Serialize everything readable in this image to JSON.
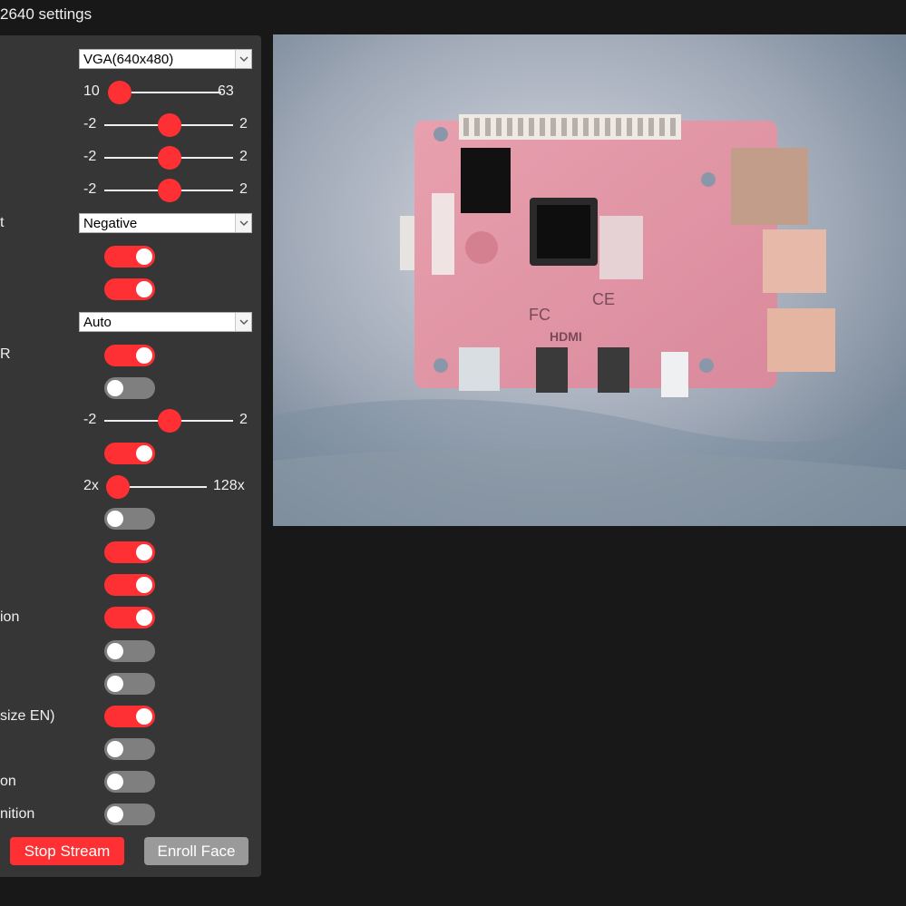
{
  "header": {
    "title": "2640 settings"
  },
  "controls": {
    "resolution": {
      "value": "VGA(640x480)"
    },
    "quality": {
      "min": "10",
      "max": "63"
    },
    "brightness": {
      "min": "-2",
      "max": "2"
    },
    "contrast": {
      "min": "-2",
      "max": "2"
    },
    "saturation": {
      "min": "-2",
      "max": "2"
    },
    "special_effect": {
      "label": "t",
      "value": "Negative"
    },
    "toggle_1": {
      "on": true
    },
    "toggle_2": {
      "on": true
    },
    "wb_mode": {
      "value": "Auto"
    },
    "ctrl_r": {
      "label": "R",
      "on": true
    },
    "toggle_4": {
      "on": false
    },
    "ae_level": {
      "min": "-2",
      "max": "2"
    },
    "toggle_5": {
      "on": true
    },
    "gain_ceiling": {
      "min": "2x",
      "max": "128x"
    },
    "toggle_6": {
      "on": false
    },
    "toggle_7": {
      "on": true
    },
    "toggle_8": {
      "on": true
    },
    "ctrl_ion": {
      "label": "ion",
      "on": true
    },
    "toggle_10": {
      "on": false
    },
    "toggle_11": {
      "on": false
    },
    "ctrl_dcw": {
      "label": "size EN)",
      "on": true
    },
    "toggle_13": {
      "on": false
    },
    "ctrl_on": {
      "label": "on",
      "on": false
    },
    "ctrl_nition": {
      "label": "nition",
      "on": false
    }
  },
  "buttons": {
    "stop_stream": "Stop Stream",
    "enroll_face": "Enroll Face"
  },
  "colors": {
    "accent": "#ff3034",
    "panel": "#363636",
    "background": "#181818",
    "toggle_off": "#7f7f7f",
    "button_disabled": "#9a9a9a"
  },
  "stream": {
    "board_text": {
      "hdmi": "HDMI",
      "fcc": "FC",
      "ce": "CE"
    }
  }
}
